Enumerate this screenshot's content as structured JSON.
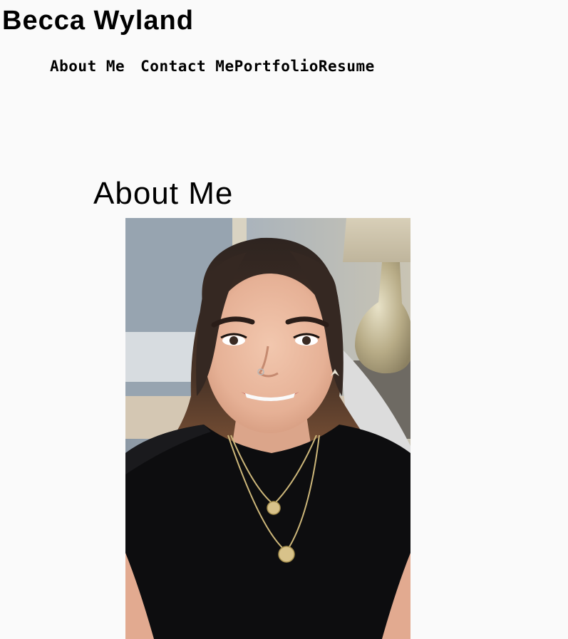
{
  "header": {
    "site_title": "Becca Wyland"
  },
  "nav": {
    "items": [
      {
        "label": "About Me"
      },
      {
        "label": "Contact Me"
      },
      {
        "label": "Portfolio"
      },
      {
        "label": "Resume"
      }
    ]
  },
  "main": {
    "heading": "About Me",
    "photo_alt": "portrait-photo"
  },
  "colors": {
    "background": "#fafafa",
    "text": "#000000",
    "shirt": "#0d0d0f",
    "hair": "#3a2a22",
    "skin": "#e9b9a0"
  }
}
